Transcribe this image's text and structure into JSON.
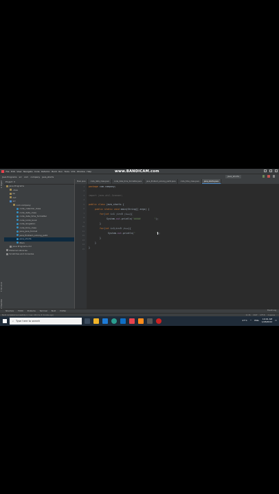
{
  "menu": [
    "File",
    "Edit",
    "View",
    "Navigate",
    "Code",
    "Refactor",
    "Build",
    "Run",
    "Tools",
    "VCS",
    "Window",
    "Help"
  ],
  "watermark": "www.BANDICAM.com",
  "breadcrumb": [
    "Java Programs",
    "src",
    "com",
    "company",
    "java_shorts"
  ],
  "run_config": "java_shorts",
  "project_panel": {
    "title": "Project",
    "tree": [
      {
        "label": "Java Programs",
        "indent": 0,
        "icon": "fold"
      },
      {
        "label": ".idea",
        "indent": 1,
        "icon": "fold"
      },
      {
        "label": "lib",
        "indent": 1,
        "icon": "fold"
      },
      {
        "label": "out",
        "indent": 1,
        "icon": "fold"
      },
      {
        "label": "src",
        "indent": 1,
        "icon": "src"
      },
      {
        "label": "com.company",
        "indent": 2,
        "icon": "fold"
      },
      {
        "label": "code_calendar_class",
        "indent": 3,
        "icon": "jcls"
      },
      {
        "label": "code_data_class",
        "indent": 3,
        "icon": "jcls"
      },
      {
        "label": "code_date_time_formatter",
        "indent": 3,
        "icon": "jcls"
      },
      {
        "label": "code_lomb_book",
        "indent": 3,
        "icon": "jcls"
      },
      {
        "label": "code_Singleton",
        "indent": 3,
        "icon": "jcls"
      },
      {
        "label": "code_time_class",
        "indent": 3,
        "icon": "jcls"
      },
      {
        "label": "java_java_format",
        "indent": 3,
        "icon": "jcls"
      },
      {
        "label": "java_Problem_solving_pat4",
        "indent": 3,
        "icon": "jcls"
      },
      {
        "label": "java_shorts",
        "indent": 3,
        "icon": "jcls"
      },
      {
        "label": "Main",
        "indent": 3,
        "icon": "jcls"
      },
      {
        "label": "Java Programs.iml",
        "indent": 1,
        "icon": "lib"
      },
      {
        "label": "External Libraries",
        "indent": 0,
        "icon": "lib"
      },
      {
        "label": "Scratches and Consoles",
        "indent": 0,
        "icon": "lib"
      }
    ]
  },
  "tabs": [
    "Main.java",
    "code_data_class.java",
    "code_date_time_formatter.java",
    "java_Problem_solving_part4.java",
    "code_time_class.java",
    "java_shorts.java"
  ],
  "active_tab": 5,
  "code": {
    "l1_kw": "package ",
    "l1_rest": "com.company;",
    "l3_kw": "import ",
    "l3_rest": "java.util.Scanner;",
    "l5_kw": "public class ",
    "l5_rest": "java_shorts {",
    "l6_kw": "public static void ",
    "l6_rest": "main(String[] args) {",
    "l7_kw": "for",
    "l7_a": "(",
    "l7_kw2": "int ",
    "l7_b": "i=1 ;i<=5 ;i++){",
    "l8_a": "System.",
    "l8_fld": "out",
    "l8_b": ".println(",
    "l8_str": "\"#####          \"",
    "l8_c": ");",
    "l9": "}",
    "l10_kw": "for",
    "l10_a": "(",
    "l10_kw2": "int ",
    "l10_b": "i=1;i<=5 ;i++){",
    "l11_a": "System.",
    "l11_fld": "out",
    "l11_b": ".println(",
    "l11_str": "\"               \"",
    "l11_c": ");",
    "l12": "}",
    "l13": "}",
    "l14": "}"
  },
  "line_numbers": [
    "1",
    "2",
    "3",
    "4",
    "5",
    "6",
    "7",
    "8",
    "9",
    "10",
    "11",
    "12",
    "13",
    "14",
    "15"
  ],
  "left_strip": [
    "1: Project",
    "7: Structure",
    "2: Favorites"
  ],
  "bottom_tools": [
    "Structure",
    "TODO",
    "Problems",
    "Terminal",
    "Build",
    "Profiler"
  ],
  "event_log": "Event Log",
  "status_msg": "Build completed successfully in 1 sec, 432 ms (3 minutes ago)",
  "status_right": [
    "11:36",
    "CRLF",
    "UTF-8",
    "4 spaces"
  ],
  "taskbar": {
    "search_placeholder": "Type here to search",
    "weather": "27°C",
    "lang": "ENG",
    "time": "10:01 AM",
    "date": "1/28/2022"
  }
}
